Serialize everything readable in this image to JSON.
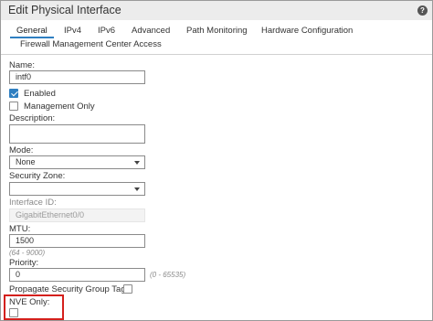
{
  "dialog": {
    "title": "Edit Physical Interface",
    "help_icon": "?"
  },
  "tabs": [
    {
      "label": "General",
      "active": true
    },
    {
      "label": "IPv4"
    },
    {
      "label": "IPv6"
    },
    {
      "label": "Advanced"
    },
    {
      "label": "Path Monitoring"
    },
    {
      "label": "Hardware Configuration"
    },
    {
      "label": "Firewall Management Center Access"
    }
  ],
  "form": {
    "name": {
      "label": "Name:",
      "value": "intf0"
    },
    "enabled": {
      "label": "Enabled",
      "checked": true
    },
    "management_only": {
      "label": "Management Only",
      "checked": false
    },
    "description": {
      "label": "Description:",
      "value": ""
    },
    "mode": {
      "label": "Mode:",
      "value": "None"
    },
    "security_zone": {
      "label": "Security Zone:",
      "value": ""
    },
    "interface_id": {
      "label": "Interface ID:",
      "value": "GigabitEthernet0/0"
    },
    "mtu": {
      "label": "MTU:",
      "value": "1500",
      "hint": "(64 - 9000)"
    },
    "priority": {
      "label": "Priority:",
      "value": "0",
      "hint": "(0 - 65535)"
    },
    "propagate_sgt": {
      "label": "Propagate Security Group Tag:",
      "checked": false
    },
    "nve_only": {
      "label": "NVE Only:",
      "checked": false
    }
  },
  "colors": {
    "accent": "#2f7fc1",
    "highlight": "#d4201c"
  }
}
